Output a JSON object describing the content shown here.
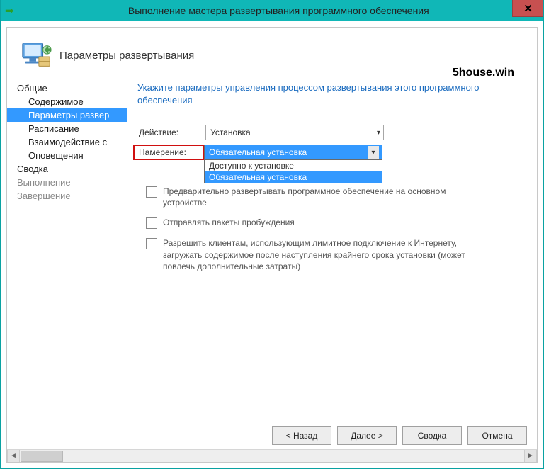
{
  "window": {
    "title": "Выполнение мастера развертывания программного обеспечения",
    "close_glyph": "✕"
  },
  "header": {
    "title": "Параметры развертывания",
    "watermark": "5house.win"
  },
  "sidebar": {
    "items": [
      {
        "label": "Общие",
        "type": "top"
      },
      {
        "label": "Содержимое",
        "type": "sub"
      },
      {
        "label": "Параметры развер",
        "type": "sub",
        "selected": true
      },
      {
        "label": "Расписание",
        "type": "sub"
      },
      {
        "label": "Взаимодействие с",
        "type": "sub"
      },
      {
        "label": "Оповещения",
        "type": "sub"
      },
      {
        "label": "Сводка",
        "type": "top"
      },
      {
        "label": "Выполнение",
        "type": "top",
        "disabled": true
      },
      {
        "label": "Завершение",
        "type": "top",
        "disabled": true
      }
    ]
  },
  "main": {
    "instruction": "Укажите параметры управления процессом развертывания этого программного обеспечения",
    "action": {
      "label": "Действие:",
      "value": "Установка"
    },
    "intent": {
      "label": "Намерение:",
      "value": "Обязательная установка",
      "options": [
        "Доступно к установке",
        "Обязательная установка"
      ],
      "selected_index": 1
    },
    "checkboxes": {
      "predeploy": "Предварительно развертывать программное обеспечение на основном устройстве",
      "sendwake": "Отправлять пакеты пробуждения",
      "metered": "Разрешить клиентам, использующим лимитное подключение к Интернету, загружать содержимое после наступления крайнего срока установки (может повлечь дополнительные затраты)"
    }
  },
  "buttons": {
    "back": "< Назад",
    "next": "Далее >",
    "summary": "Сводка",
    "cancel": "Отмена"
  }
}
